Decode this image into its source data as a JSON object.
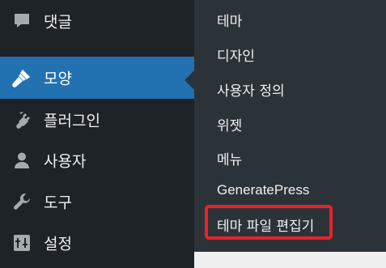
{
  "sidebar": {
    "items": [
      {
        "label": "댓글",
        "icon": "comment-icon"
      },
      {
        "label": "모양",
        "icon": "appearance-brush-icon"
      },
      {
        "label": "플러그인",
        "icon": "plugin-icon"
      },
      {
        "label": "사용자",
        "icon": "user-icon"
      },
      {
        "label": "도구",
        "icon": "wrench-icon"
      },
      {
        "label": "설정",
        "icon": "settings-icon"
      }
    ]
  },
  "submenu": {
    "items": [
      {
        "label": "테마"
      },
      {
        "label": "디자인"
      },
      {
        "label": "사용자 정의"
      },
      {
        "label": "위젯"
      },
      {
        "label": "메뉴"
      },
      {
        "label": "GeneratePress"
      },
      {
        "label": "테마 파일 편집기"
      }
    ]
  },
  "colors": {
    "sidebar_bg": "#1d2327",
    "submenu_bg": "#2c3338",
    "current_bg": "#2271b1",
    "highlight_border": "#e8222c",
    "icon_gray": "#a7aaad"
  }
}
